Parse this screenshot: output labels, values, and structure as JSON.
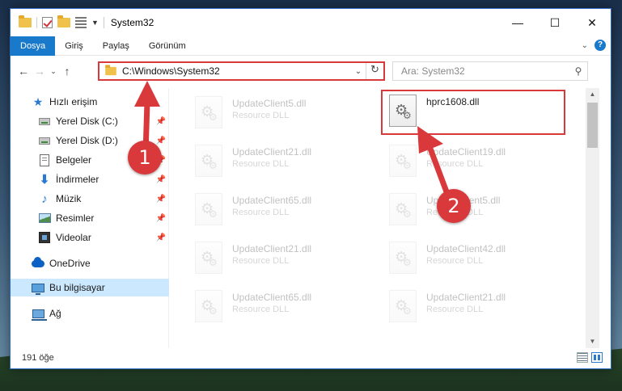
{
  "window": {
    "title": "System32",
    "controls": {
      "minimize": "—",
      "maximize": "☐",
      "close": "✕"
    }
  },
  "ribbon": {
    "tabs": [
      {
        "label": "Dosya",
        "active": true
      },
      {
        "label": "Giriş",
        "active": false
      },
      {
        "label": "Paylaş",
        "active": false
      },
      {
        "label": "Görünüm",
        "active": false
      }
    ],
    "help": "?"
  },
  "nav": {
    "back": "←",
    "forward": "→",
    "recent": "⌄",
    "up": "↑",
    "address": "C:\\Windows\\System32",
    "refresh": "↻",
    "search_placeholder": "Ara: System32",
    "search_icon": "⚲"
  },
  "sidebar": {
    "items": [
      {
        "label": "Hızlı erişim",
        "icon": "star-icon"
      },
      {
        "label": "Yerel Disk (C:)",
        "icon": "drive-icon",
        "pinned": true
      },
      {
        "label": "Yerel Disk (D:)",
        "icon": "drive-icon",
        "pinned": true
      },
      {
        "label": "Belgeler",
        "icon": "documents-icon",
        "pinned": true
      },
      {
        "label": "İndirmeler",
        "icon": "downloads-icon",
        "pinned": true
      },
      {
        "label": "Müzik",
        "icon": "music-icon",
        "pinned": true
      },
      {
        "label": "Resimler",
        "icon": "pictures-icon",
        "pinned": true
      },
      {
        "label": "Videolar",
        "icon": "videos-icon",
        "pinned": true
      },
      {
        "label": "OneDrive",
        "icon": "onedrive-icon"
      },
      {
        "label": "Bu bilgisayar",
        "icon": "this-pc-icon",
        "selected": true
      },
      {
        "label": "Ağ",
        "icon": "network-icon"
      }
    ]
  },
  "files": [
    {
      "name": "UpdateClient5.dll",
      "type": "Resource DLL"
    },
    {
      "name": "hprc1608.dll",
      "type": ""
    },
    {
      "name": "UpdateClient21.dll",
      "type": "Resource DLL"
    },
    {
      "name": "UpdateClient19.dll",
      "type": "Resource DLL"
    },
    {
      "name": "UpdateClient65.dll",
      "type": "Resource DLL"
    },
    {
      "name": "UpdateClient5.dll",
      "type": "Resource DLL"
    },
    {
      "name": "UpdateClient21.dll",
      "type": "Resource DLL"
    },
    {
      "name": "UpdateClient42.dll",
      "type": "Resource DLL"
    },
    {
      "name": "UpdateClient65.dll",
      "type": "Resource DLL"
    },
    {
      "name": "UpdateClient21.dll",
      "type": "Resource DLL"
    }
  ],
  "status": {
    "item_count": "191 öğe"
  },
  "annotations": {
    "step1": "1",
    "step2": "2",
    "color": "#d9393b"
  }
}
